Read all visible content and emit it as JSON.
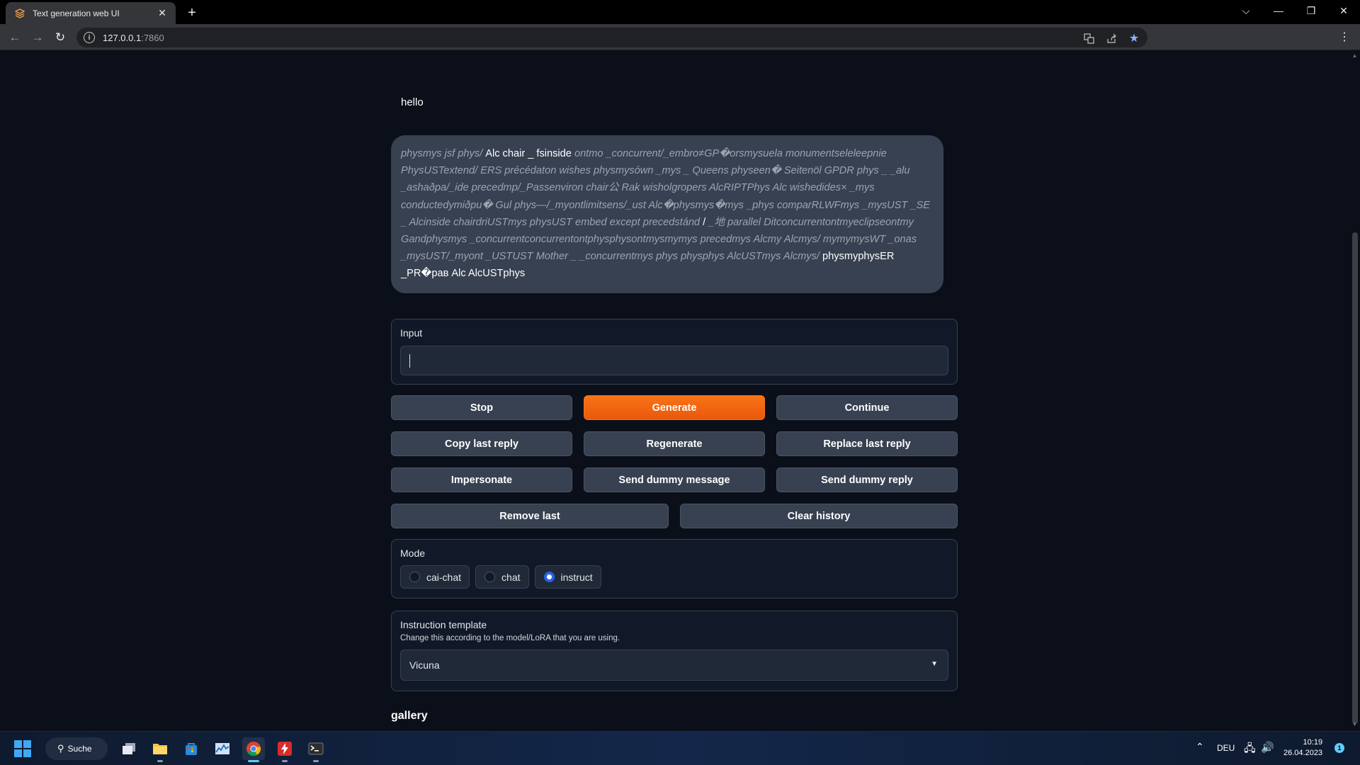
{
  "browser": {
    "tab_title": "Text generation web UI",
    "url_host": "127.0.0.1",
    "url_port": ":7860"
  },
  "chat": {
    "user_message": "hello",
    "bot_segments": [
      {
        "style": "dim",
        "text": "physmys jsf phys/ "
      },
      {
        "style": "hi",
        "text": "Alc chair _ fsinside "
      },
      {
        "style": "dim",
        "text": "ontmo _concurrent/_embro≠GP�orsmysuela monumentseleleepnie PhysUSTextend/ ERS précédaton wishes physmysówn _mys _ Queens physeen� Seitenöl GPDR phys _ _alu _ashaðpa/_ide precedmp/_Passenviron chair公 Rak wisholgropers AlcRIPTPhys Alc wishedides× _mys conductedymiðpu� Gul phys—/_myontlimitsens/_ust Alc�physmys�mys _phys comparRLWFmys _mysUST _SE _ Alcinside chairdriUSTmys physUST embed except precedstánd "
      },
      {
        "style": "hi",
        "text": "/ "
      },
      {
        "style": "dim",
        "text": "_地 parallel Ditconcurrentontmyeclipseontmy Gandphysmys _concurrentconcurrentontphysphysontmysmymys precedmys Alcmy Alcmys/ mymymysWT _onas _mysUST/_myont _USTUST Mother _ _concurrentmys phys physphys AlcUSTmys Alcmys/ "
      },
      {
        "style": "hi",
        "text": "physmyphysER _PR�paв Alc AlcUSTphys"
      }
    ]
  },
  "input": {
    "label": "Input",
    "value": ""
  },
  "buttons": {
    "stop": "Stop",
    "generate": "Generate",
    "continue": "Continue",
    "copy_last_reply": "Copy last reply",
    "regenerate": "Regenerate",
    "replace_last_reply": "Replace last reply",
    "impersonate": "Impersonate",
    "send_dummy_message": "Send dummy message",
    "send_dummy_reply": "Send dummy reply",
    "remove_last": "Remove last",
    "clear_history": "Clear history"
  },
  "mode": {
    "label": "Mode",
    "options": [
      "cai-chat",
      "chat",
      "instruct"
    ],
    "selected": "instruct"
  },
  "instruction_template": {
    "label": "Instruction template",
    "info": "Change this according to the model/LoRA that you are using.",
    "value": "Vicuna"
  },
  "gallery": {
    "title": "gallery"
  },
  "taskbar": {
    "search_label": "Suche",
    "language": "DEU",
    "time": "10:19",
    "date": "26.04.2023",
    "notification_count": "1"
  },
  "colors": {
    "accent_orange": "#f97316",
    "radio_selected": "#2563eb",
    "page_background": "#0b0f19",
    "panel_background": "#111827"
  }
}
